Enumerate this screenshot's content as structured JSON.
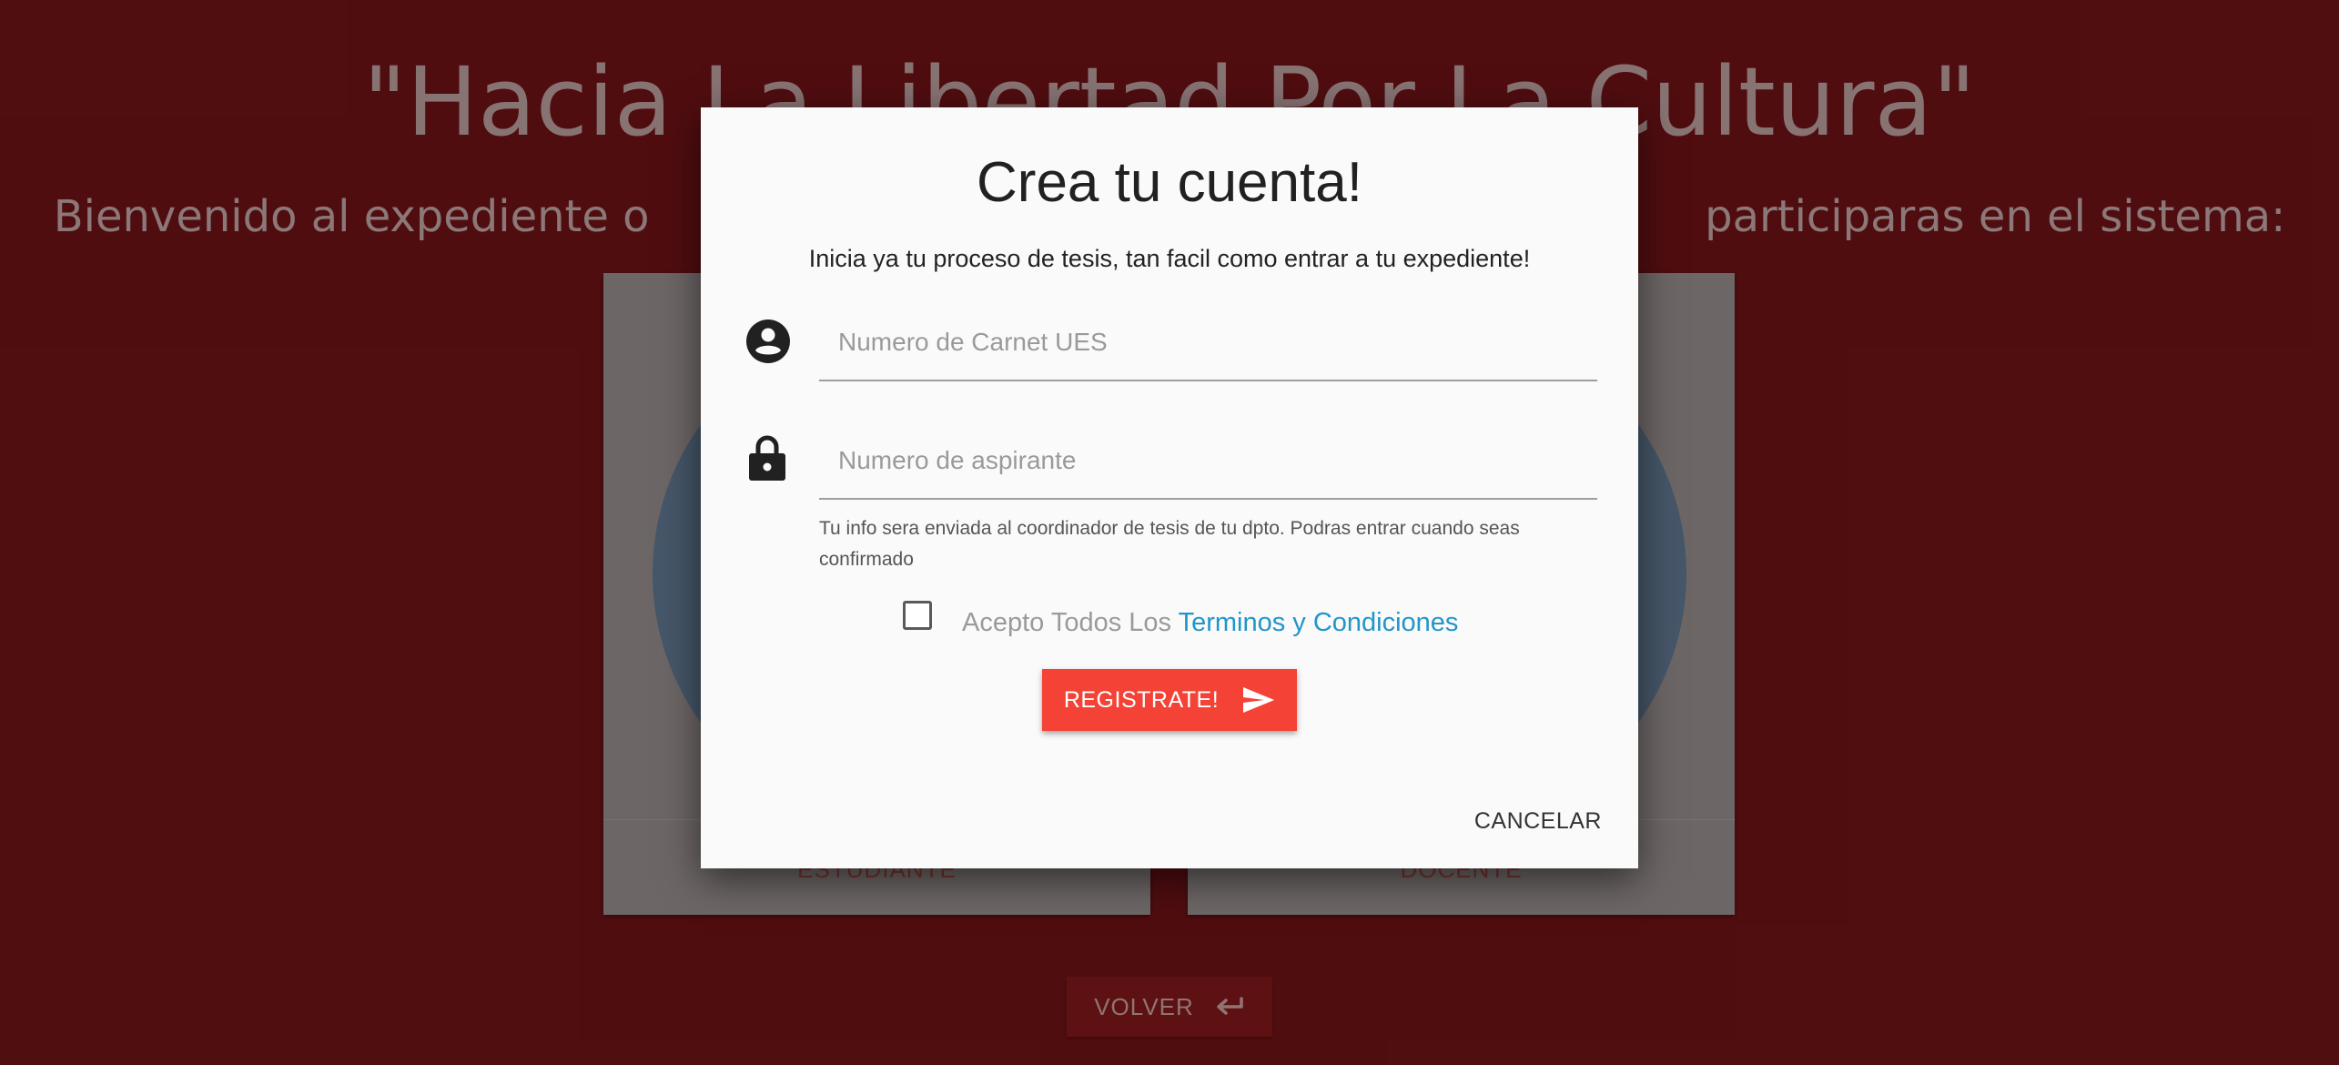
{
  "background": {
    "title": "\"Hacia La Libertad Por La Cultura\"",
    "subtitle": "Bienvenido al expediente o                                                                            participaras en el sistema:",
    "cards": [
      {
        "label": "ESTUDIANTE"
      },
      {
        "label": "DOCENTE"
      }
    ],
    "volver_label": "VOLVER"
  },
  "modal": {
    "title": "Crea tu cuenta!",
    "subtitle": "Inicia ya tu proceso de tesis, tan facil como entrar a tu expediente!",
    "carnet": {
      "placeholder": "Numero de Carnet UES",
      "value": ""
    },
    "aspirante": {
      "placeholder": "Numero de aspirante",
      "value": ""
    },
    "helper_text": "Tu info sera enviada al coordinador de tesis de tu dpto. Podras entrar cuando seas confirmado",
    "terms_prefix": "Acepto Todos Los ",
    "terms_link": "Terminos y Condiciones",
    "terms_checked": false,
    "register_label": "REGISTRATE!",
    "cancel_label": "CANCELAR"
  },
  "colors": {
    "background": "#5a1114",
    "accent": "#f44336",
    "link": "#2196c8"
  },
  "icons": [
    "account-circle-icon",
    "lock-icon",
    "send-icon",
    "return-arrow-icon"
  ]
}
